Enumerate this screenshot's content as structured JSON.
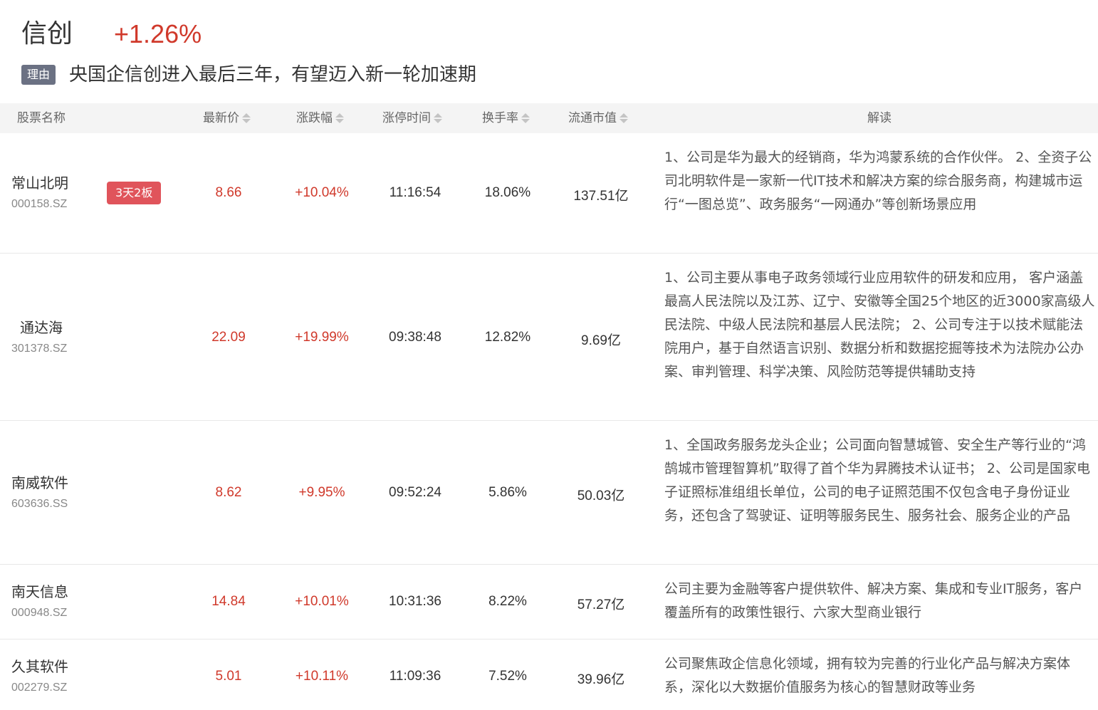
{
  "sector": {
    "name": "信创",
    "change": "+1.26%",
    "reason_label": "理由",
    "reason_text": "央国企信创进入最后三年，有望迈入新一轮加速期"
  },
  "table": {
    "headers": {
      "name": "股票名称",
      "price": "最新价",
      "change": "涨跌幅",
      "limit_time": "涨停时间",
      "turnover": "换手率",
      "float_cap": "流通市值",
      "analysis": "解读"
    },
    "rows": [
      {
        "name": "常山北明",
        "code": "000158.SZ",
        "tag": "3天2板",
        "price": "8.66",
        "change": "+10.04%",
        "limit_time": "11:16:54",
        "turnover": "18.06%",
        "float_cap": "137.51亿",
        "analysis": "1、公司是华为最大的经销商，华为鸿蒙系统的合作伙伴。 2、全资子公司北明软件是一家新一代IT技术和解决方案的综合服务商，构建城市运行“一图总览”、政务服务“一网通办”等创新场景应用"
      },
      {
        "name": "通达海",
        "code": "301378.SZ",
        "tag": "",
        "price": "22.09",
        "change": "+19.99%",
        "limit_time": "09:38:48",
        "turnover": "12.82%",
        "float_cap": "9.69亿",
        "analysis": "1、公司主要从事电子政务领域行业应用软件的研发和应用， 客户涵盖最高人民法院以及江苏、辽宁、安徽等全国25个地区的近3000家高级人民法院、中级人民法院和基层人民法院； 2、公司专注于以技术赋能法院用户，基于自然语言识别、数据分析和数据挖掘等技术为法院办公办案、审判管理、科学决策、风险防范等提供辅助支持"
      },
      {
        "name": "南威软件",
        "code": "603636.SS",
        "tag": "",
        "price": "8.62",
        "change": "+9.95%",
        "limit_time": "09:52:24",
        "turnover": "5.86%",
        "float_cap": "50.03亿",
        "analysis": "1、全国政务服务龙头企业；公司面向智慧城管、安全生产等行业的“鸿鹄城市管理智算机”取得了首个华为昇腾技术认证书； 2、公司是国家电子证照标准组组长单位，公司的电子证照范围不仅包含电子身份证业务，还包含了驾驶证、证明等服务民生、服务社会、服务企业的产品"
      },
      {
        "name": "南天信息",
        "code": "000948.SZ",
        "tag": "",
        "price": "14.84",
        "change": "+10.01%",
        "limit_time": "10:31:36",
        "turnover": "8.22%",
        "float_cap": "57.27亿",
        "analysis": "公司主要为金融等客户提供软件、解决方案、集成和专业IT服务，客户覆盖所有的政策性银行、六家大型商业银行"
      },
      {
        "name": "久其软件",
        "code": "002279.SZ",
        "tag": "",
        "price": "5.01",
        "change": "+10.11%",
        "limit_time": "11:09:36",
        "turnover": "7.52%",
        "float_cap": "39.96亿",
        "analysis": "公司聚焦政企信息化领域，拥有较为完善的行业化产品与解决方案体系，深化以大数据价值服务为核心的智慧财政等业务"
      }
    ]
  }
}
